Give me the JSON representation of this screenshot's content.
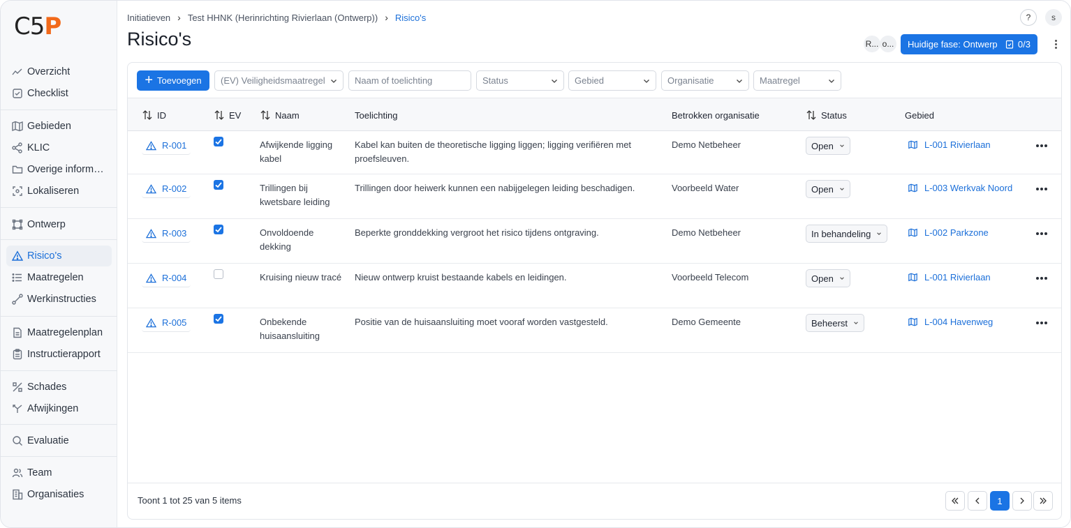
{
  "brand": {
    "logo_main": "C5",
    "logo_accent": "P"
  },
  "sidebar": {
    "groups": [
      [
        {
          "label": "Overzicht",
          "icon": "trend-icon"
        },
        {
          "label": "Checklist",
          "icon": "checkbox-icon"
        }
      ],
      [
        {
          "label": "Gebieden",
          "icon": "map-icon"
        },
        {
          "label": "KLIC",
          "icon": "share-icon"
        },
        {
          "label": "Overige informatie",
          "icon": "folder-icon"
        },
        {
          "label": "Lokaliseren",
          "icon": "locate-icon"
        }
      ],
      [
        {
          "label": "Ontwerp",
          "icon": "design-icon"
        }
      ],
      [
        {
          "label": "Risico's",
          "icon": "warning-icon"
        },
        {
          "label": "Maatregelen",
          "icon": "list-icon"
        },
        {
          "label": "Werkinstructies",
          "icon": "route-icon"
        }
      ],
      [
        {
          "label": "Maatregelenplan",
          "icon": "document-icon"
        },
        {
          "label": "Instructierapport",
          "icon": "clipboard-icon"
        }
      ],
      [
        {
          "label": "Schades",
          "icon": "tool-icon"
        },
        {
          "label": "Afwijkingen",
          "icon": "split-icon"
        }
      ],
      [
        {
          "label": "Evaluatie",
          "icon": "search-icon"
        }
      ],
      [
        {
          "label": "Team",
          "icon": "users-icon"
        },
        {
          "label": "Organisaties",
          "icon": "building-icon"
        }
      ]
    ]
  },
  "breadcrumb": {
    "items": [
      "Initiatieven",
      "Test HHNK (Herinrichting Rivierlaan (Ontwerp))",
      "Risico's"
    ]
  },
  "header": {
    "title": "Risico's",
    "help": "?",
    "user_initial": "s",
    "avatar_1": "R...",
    "avatar_2": "o...",
    "phase_label": "Huidige fase: Ontwerp",
    "phase_count": "0/3"
  },
  "toolbar": {
    "add_label": "Toevoegen",
    "filters": [
      "(EV) Veiligheidsmaatregel",
      "Naam of toelichting",
      "Status",
      "Gebied",
      "Organisatie",
      "Maatregel"
    ]
  },
  "table": {
    "columns": {
      "id": "ID",
      "ev": "EV",
      "name": "Naam",
      "desc": "Toelichting",
      "org": "Betrokken organisatie",
      "status": "Status",
      "area": "Gebied"
    },
    "rows": [
      {
        "id": "R-001",
        "ev": true,
        "name": "Afwijkende ligging kabel",
        "desc": "Kabel kan buiten de theoretische ligging liggen; ligging verifiëren met proefsleuven.",
        "org": "Demo Netbeheer",
        "status": "Open",
        "area": "L-001 Rivierlaan"
      },
      {
        "id": "R-002",
        "ev": true,
        "name": "Trillingen bij kwetsbare leiding",
        "desc": "Trillingen door heiwerk kunnen een nabijgelegen leiding beschadigen.",
        "org": "Voorbeeld Water",
        "status": "Open",
        "area": "L-003 Werkvak Noord"
      },
      {
        "id": "R-003",
        "ev": true,
        "name": "Onvoldoende dekking",
        "desc": "Beperkte gronddekking vergroot het risico tijdens ontgraving.",
        "org": "Demo Netbeheer",
        "status": "In behandeling",
        "area": "L-002 Parkzone"
      },
      {
        "id": "R-004",
        "ev": false,
        "name": "Kruising nieuw tracé",
        "desc": "Nieuw ontwerp kruist bestaande kabels en leidingen.",
        "org": "Voorbeeld Telecom",
        "status": "Open",
        "area": "L-001 Rivierlaan"
      },
      {
        "id": "R-005",
        "ev": true,
        "name": "Onbekende huisaansluiting",
        "desc": "Positie van de huisaansluiting moet vooraf worden vastgesteld.",
        "org": "Demo Gemeente",
        "status": "Beheerst",
        "area": "L-004 Havenweg"
      }
    ]
  },
  "footer": {
    "summary": "Toont 1 tot 25 van 5 items",
    "current_page": "1"
  },
  "colors": {
    "accent": "#1b74e4",
    "logo_accent": "#f26a1b"
  }
}
